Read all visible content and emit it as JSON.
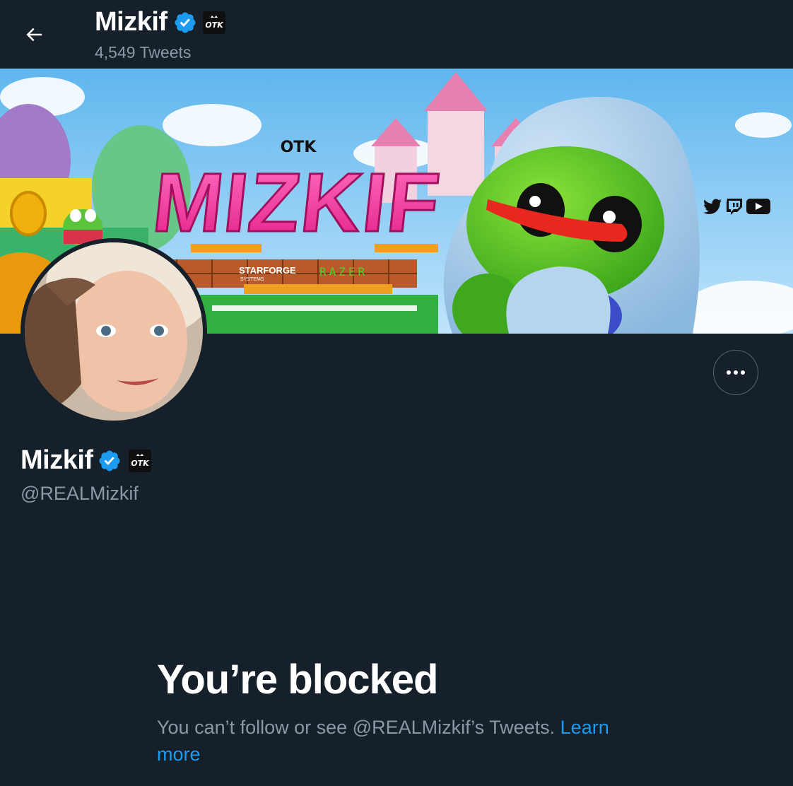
{
  "header": {
    "name": "Mizkif",
    "tweet_count": "4,549 Tweets"
  },
  "banner": {
    "logo_text": "OTK",
    "title_text": "MIZKIF",
    "sponsor_1": "STARFORGE",
    "sponsor_1_sub": "SYSTEMS",
    "sponsor_2": "RAZER"
  },
  "profile": {
    "name": "Mizkif",
    "handle": "@REALMizkif",
    "badge_text": "OTK"
  },
  "blocked": {
    "title": "You’re blocked",
    "message": "You can’t follow or see @REALMizkif’s Tweets. ",
    "link": "Learn more"
  },
  "colors": {
    "background": "#15202b",
    "verified": "#1d9bf0",
    "secondary_text": "#8b98a5",
    "link": "#1d9bf0"
  }
}
